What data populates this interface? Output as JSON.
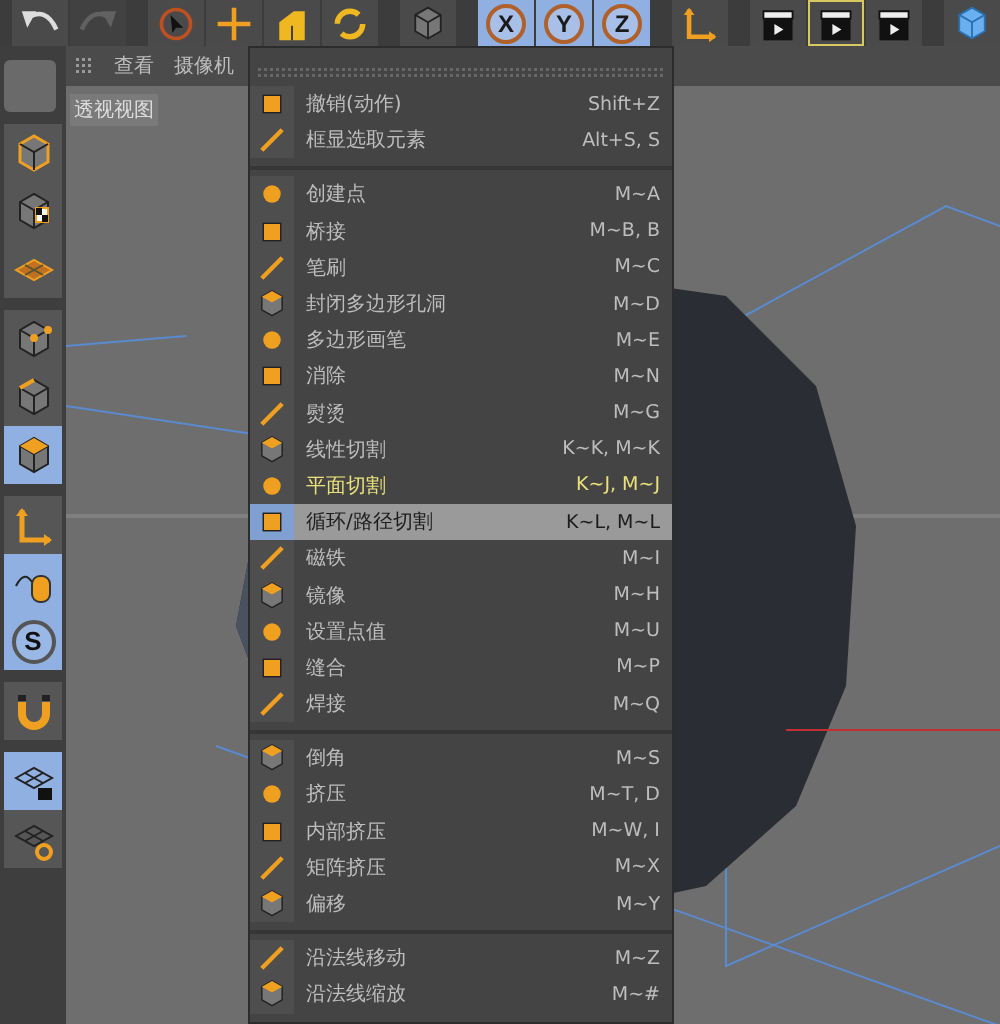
{
  "toolbar": [
    {
      "kind": "undo",
      "selected": false,
      "disabled": false
    },
    {
      "kind": "redo",
      "selected": false,
      "disabled": true
    },
    {
      "kind": "select",
      "selected": false,
      "disabled": false
    },
    {
      "kind": "move",
      "selected": false,
      "disabled": false
    },
    {
      "kind": "scale",
      "selected": false,
      "disabled": false
    },
    {
      "kind": "rotate",
      "selected": false,
      "disabled": false
    },
    {
      "kind": "object",
      "selected": false,
      "disabled": false
    },
    {
      "kind": "letter",
      "label": "X",
      "selected": true,
      "disabled": false
    },
    {
      "kind": "letter",
      "label": "Y",
      "selected": true,
      "disabled": false
    },
    {
      "kind": "letter",
      "label": "Z",
      "selected": true,
      "disabled": false
    },
    {
      "kind": "axis",
      "selected": false,
      "disabled": false
    },
    {
      "kind": "clapper",
      "selected": false,
      "disabled": false
    },
    {
      "kind": "clapper",
      "selected": true,
      "disabled": false
    },
    {
      "kind": "clapper",
      "selected": false,
      "disabled": false
    },
    {
      "kind": "cube",
      "selected": false,
      "disabled": false
    }
  ],
  "viewport": {
    "menus": [
      "查看",
      "摄像机"
    ],
    "title": "透视视图"
  },
  "sidebar": [
    [
      {
        "kind": "model",
        "selected": false
      },
      {
        "kind": "texture",
        "selected": false
      },
      {
        "kind": "plane",
        "selected": false
      }
    ],
    [
      {
        "kind": "points",
        "selected": false
      },
      {
        "kind": "edges",
        "selected": false
      },
      {
        "kind": "polygons",
        "selected": true
      }
    ],
    [
      {
        "kind": "axis",
        "selected": false
      },
      {
        "kind": "mouse",
        "selected": true
      },
      {
        "kind": "letter",
        "label": "S",
        "selected": true
      }
    ],
    [
      {
        "kind": "magnet",
        "selected": false
      }
    ],
    [
      {
        "kind": "gridlock",
        "selected": true
      },
      {
        "kind": "gridturn",
        "selected": false
      }
    ]
  ],
  "menu": [
    [
      {
        "label": "撤销(动作)",
        "shortcut": "Shift+Z",
        "active": false,
        "selected": false
      },
      {
        "label": "框显选取元素",
        "shortcut": "Alt+S, S",
        "active": false,
        "selected": false
      }
    ],
    [
      {
        "label": "创建点",
        "shortcut": "M~A",
        "active": false,
        "selected": false
      },
      {
        "label": "桥接",
        "shortcut": "M~B, B",
        "active": false,
        "selected": false
      },
      {
        "label": "笔刷",
        "shortcut": "M~C",
        "active": false,
        "selected": false
      },
      {
        "label": "封闭多边形孔洞",
        "shortcut": "M~D",
        "active": false,
        "selected": false
      },
      {
        "label": "多边形画笔",
        "shortcut": "M~E",
        "active": false,
        "selected": false
      },
      {
        "label": "消除",
        "shortcut": "M~N",
        "active": false,
        "selected": false
      },
      {
        "label": "熨烫",
        "shortcut": "M~G",
        "active": false,
        "selected": false
      },
      {
        "label": "线性切割",
        "shortcut": "K~K, M~K",
        "active": false,
        "selected": false
      },
      {
        "label": "平面切割",
        "shortcut": "K~J, M~J",
        "active": true,
        "selected": false
      },
      {
        "label": "循环/路径切割",
        "shortcut": "K~L, M~L",
        "active": false,
        "selected": true
      },
      {
        "label": "磁铁",
        "shortcut": "M~I",
        "active": false,
        "selected": false
      },
      {
        "label": "镜像",
        "shortcut": "M~H",
        "active": false,
        "selected": false
      },
      {
        "label": "设置点值",
        "shortcut": "M~U",
        "active": false,
        "selected": false
      },
      {
        "label": "缝合",
        "shortcut": "M~P",
        "active": false,
        "selected": false
      },
      {
        "label": "焊接",
        "shortcut": "M~Q",
        "active": false,
        "selected": false
      }
    ],
    [
      {
        "label": "倒角",
        "shortcut": "M~S",
        "active": false,
        "selected": false
      },
      {
        "label": "挤压",
        "shortcut": "M~T, D",
        "active": false,
        "selected": false
      },
      {
        "label": "内部挤压",
        "shortcut": "M~W, I",
        "active": false,
        "selected": false
      },
      {
        "label": "矩阵挤压",
        "shortcut": "M~X",
        "active": false,
        "selected": false
      },
      {
        "label": "偏移",
        "shortcut": "M~Y",
        "active": false,
        "selected": false
      }
    ],
    [
      {
        "label": "沿法线移动",
        "shortcut": "M~Z",
        "active": false,
        "selected": false
      },
      {
        "label": "沿法线缩放",
        "shortcut": "M~#",
        "active": false,
        "selected": false
      }
    ]
  ]
}
